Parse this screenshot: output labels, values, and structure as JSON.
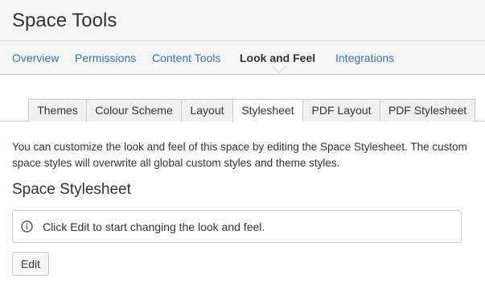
{
  "header": {
    "title": "Space Tools"
  },
  "nav": {
    "items": [
      {
        "label": "Overview"
      },
      {
        "label": "Permissions"
      },
      {
        "label": "Content Tools"
      },
      {
        "label": "Look and Feel"
      },
      {
        "label": "Integrations"
      }
    ],
    "active_index": 3
  },
  "tabs": {
    "items": [
      {
        "label": "Themes"
      },
      {
        "label": "Colour Scheme"
      },
      {
        "label": "Layout"
      },
      {
        "label": "Stylesheet"
      },
      {
        "label": "PDF Layout"
      },
      {
        "label": "PDF Stylesheet"
      }
    ],
    "active_index": 3
  },
  "main": {
    "description": "You can customize the look and feel of this space by editing the Space Stylesheet. The custom space styles will overwrite all global custom styles and theme styles.",
    "section_title": "Space Stylesheet",
    "info_message": "Click Edit to start changing the look and feel.",
    "info_icon": "info-circle-icon",
    "edit_label": "Edit"
  },
  "colors": {
    "link": "#3b73af",
    "text": "#333333",
    "header_bg": "#f5f5f5",
    "border": "#cccccc"
  }
}
